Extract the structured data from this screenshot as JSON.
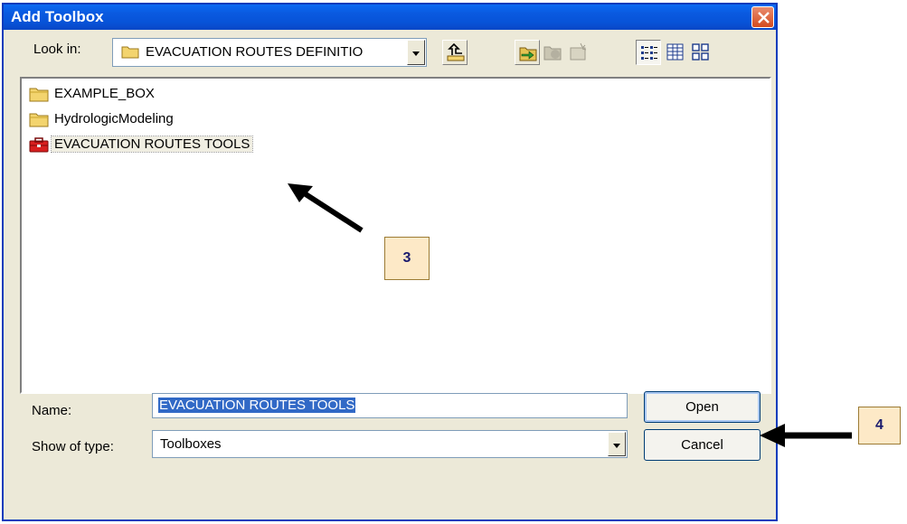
{
  "window": {
    "title": "Add Toolbox"
  },
  "look_in": {
    "label": "Look in:",
    "value": "EVACUATION ROUTES DEFINITIO"
  },
  "toolbar": {
    "icons": [
      "up-one-level-icon",
      "connect-folder-icon",
      "disconnect-folder-icon",
      "new-toolbox-icon",
      "list-view-icon",
      "details-view-icon",
      "thumbnails-view-icon"
    ]
  },
  "file_list": {
    "items": [
      {
        "label": "EXAMPLE_BOX",
        "icon": "folder-icon"
      },
      {
        "label": "HydrologicModeling",
        "icon": "folder-icon"
      },
      {
        "label": "EVACUATION ROUTES TOOLS",
        "icon": "toolbox-icon"
      }
    ]
  },
  "name": {
    "label": "Name:",
    "value": "EVACUATION ROUTES TOOLS"
  },
  "type": {
    "label": "Show of type:",
    "value": "Toolboxes"
  },
  "buttons": {
    "open": "Open",
    "cancel": "Cancel"
  },
  "callouts": {
    "step3": "3",
    "step4": "4"
  },
  "colors": {
    "titlebar": "#0a5ae0",
    "dialog_bg": "#ece9d8",
    "callout_bg": "#fde9c7",
    "selection": "#3169c6"
  }
}
